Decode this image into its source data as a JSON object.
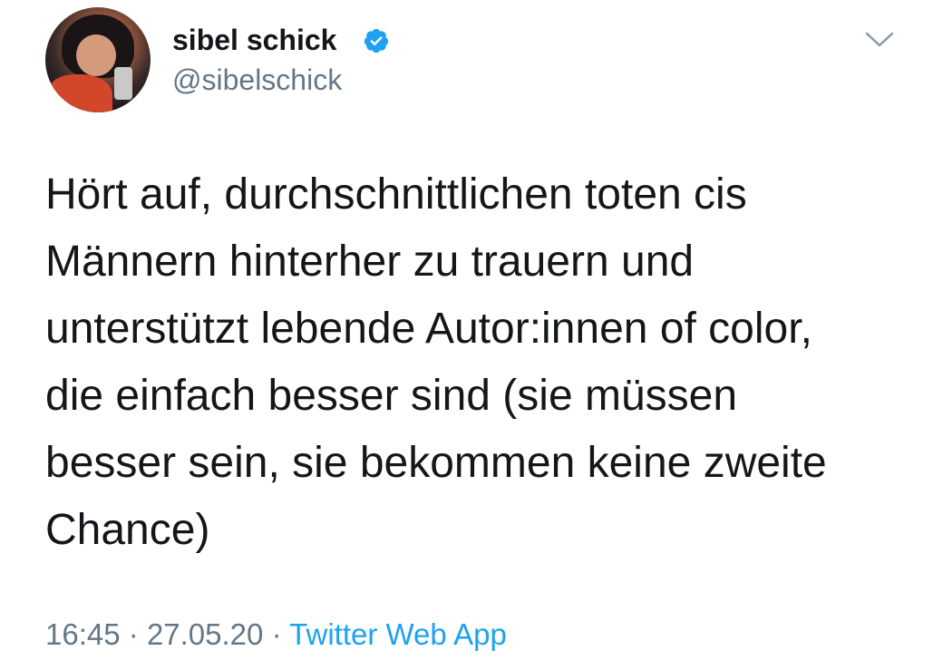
{
  "tweet": {
    "author": {
      "display_name": "sibel schick",
      "handle": "@sibelschick",
      "verified": true
    },
    "text_lines": [
      "Hört auf, durchschnittlichen toten cis",
      "Männern hinterher zu trauern und",
      "unterstützt lebende Autor:innen of color,",
      "die einfach besser sind (sie müssen",
      "besser sein, sie bekommen keine zweite",
      "Chance)"
    ],
    "time": "16:45",
    "date": "27.05.20",
    "separator": "·",
    "source": "Twitter Web App"
  },
  "icons": {
    "verified": "verified-badge-icon",
    "menu": "chevron-down-icon"
  },
  "colors": {
    "text": "#14171a",
    "secondary": "#657786",
    "link": "#1da1f2",
    "verified": "#1da1f2"
  }
}
